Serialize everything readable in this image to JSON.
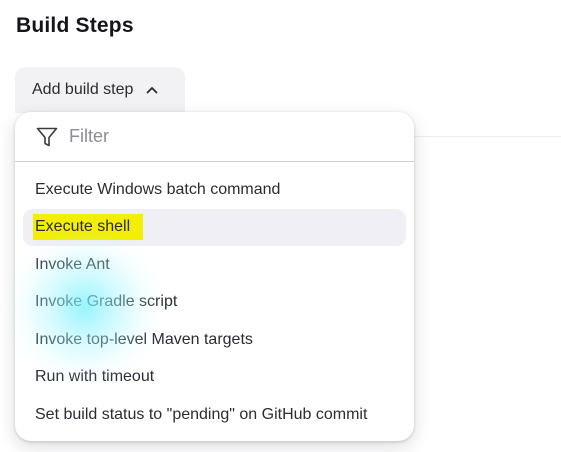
{
  "section": {
    "title": "Build Steps"
  },
  "add_button": {
    "label": "Add build step",
    "icon": "chevron-up-icon"
  },
  "filter": {
    "placeholder": "Filter",
    "value": "",
    "icon": "filter-icon"
  },
  "menu": {
    "items": [
      {
        "label": "Execute Windows batch command"
      },
      {
        "label": "Execute shell"
      },
      {
        "label": "Invoke Ant"
      },
      {
        "label": "Invoke Gradle script"
      },
      {
        "label": "Invoke top-level Maven targets"
      },
      {
        "label": "Run with timeout"
      },
      {
        "label": "Set build status to \"pending\" on GitHub commit"
      }
    ],
    "hovered_index": 1,
    "highlighted_index": 1,
    "highlight_color": "#f2ee05"
  }
}
